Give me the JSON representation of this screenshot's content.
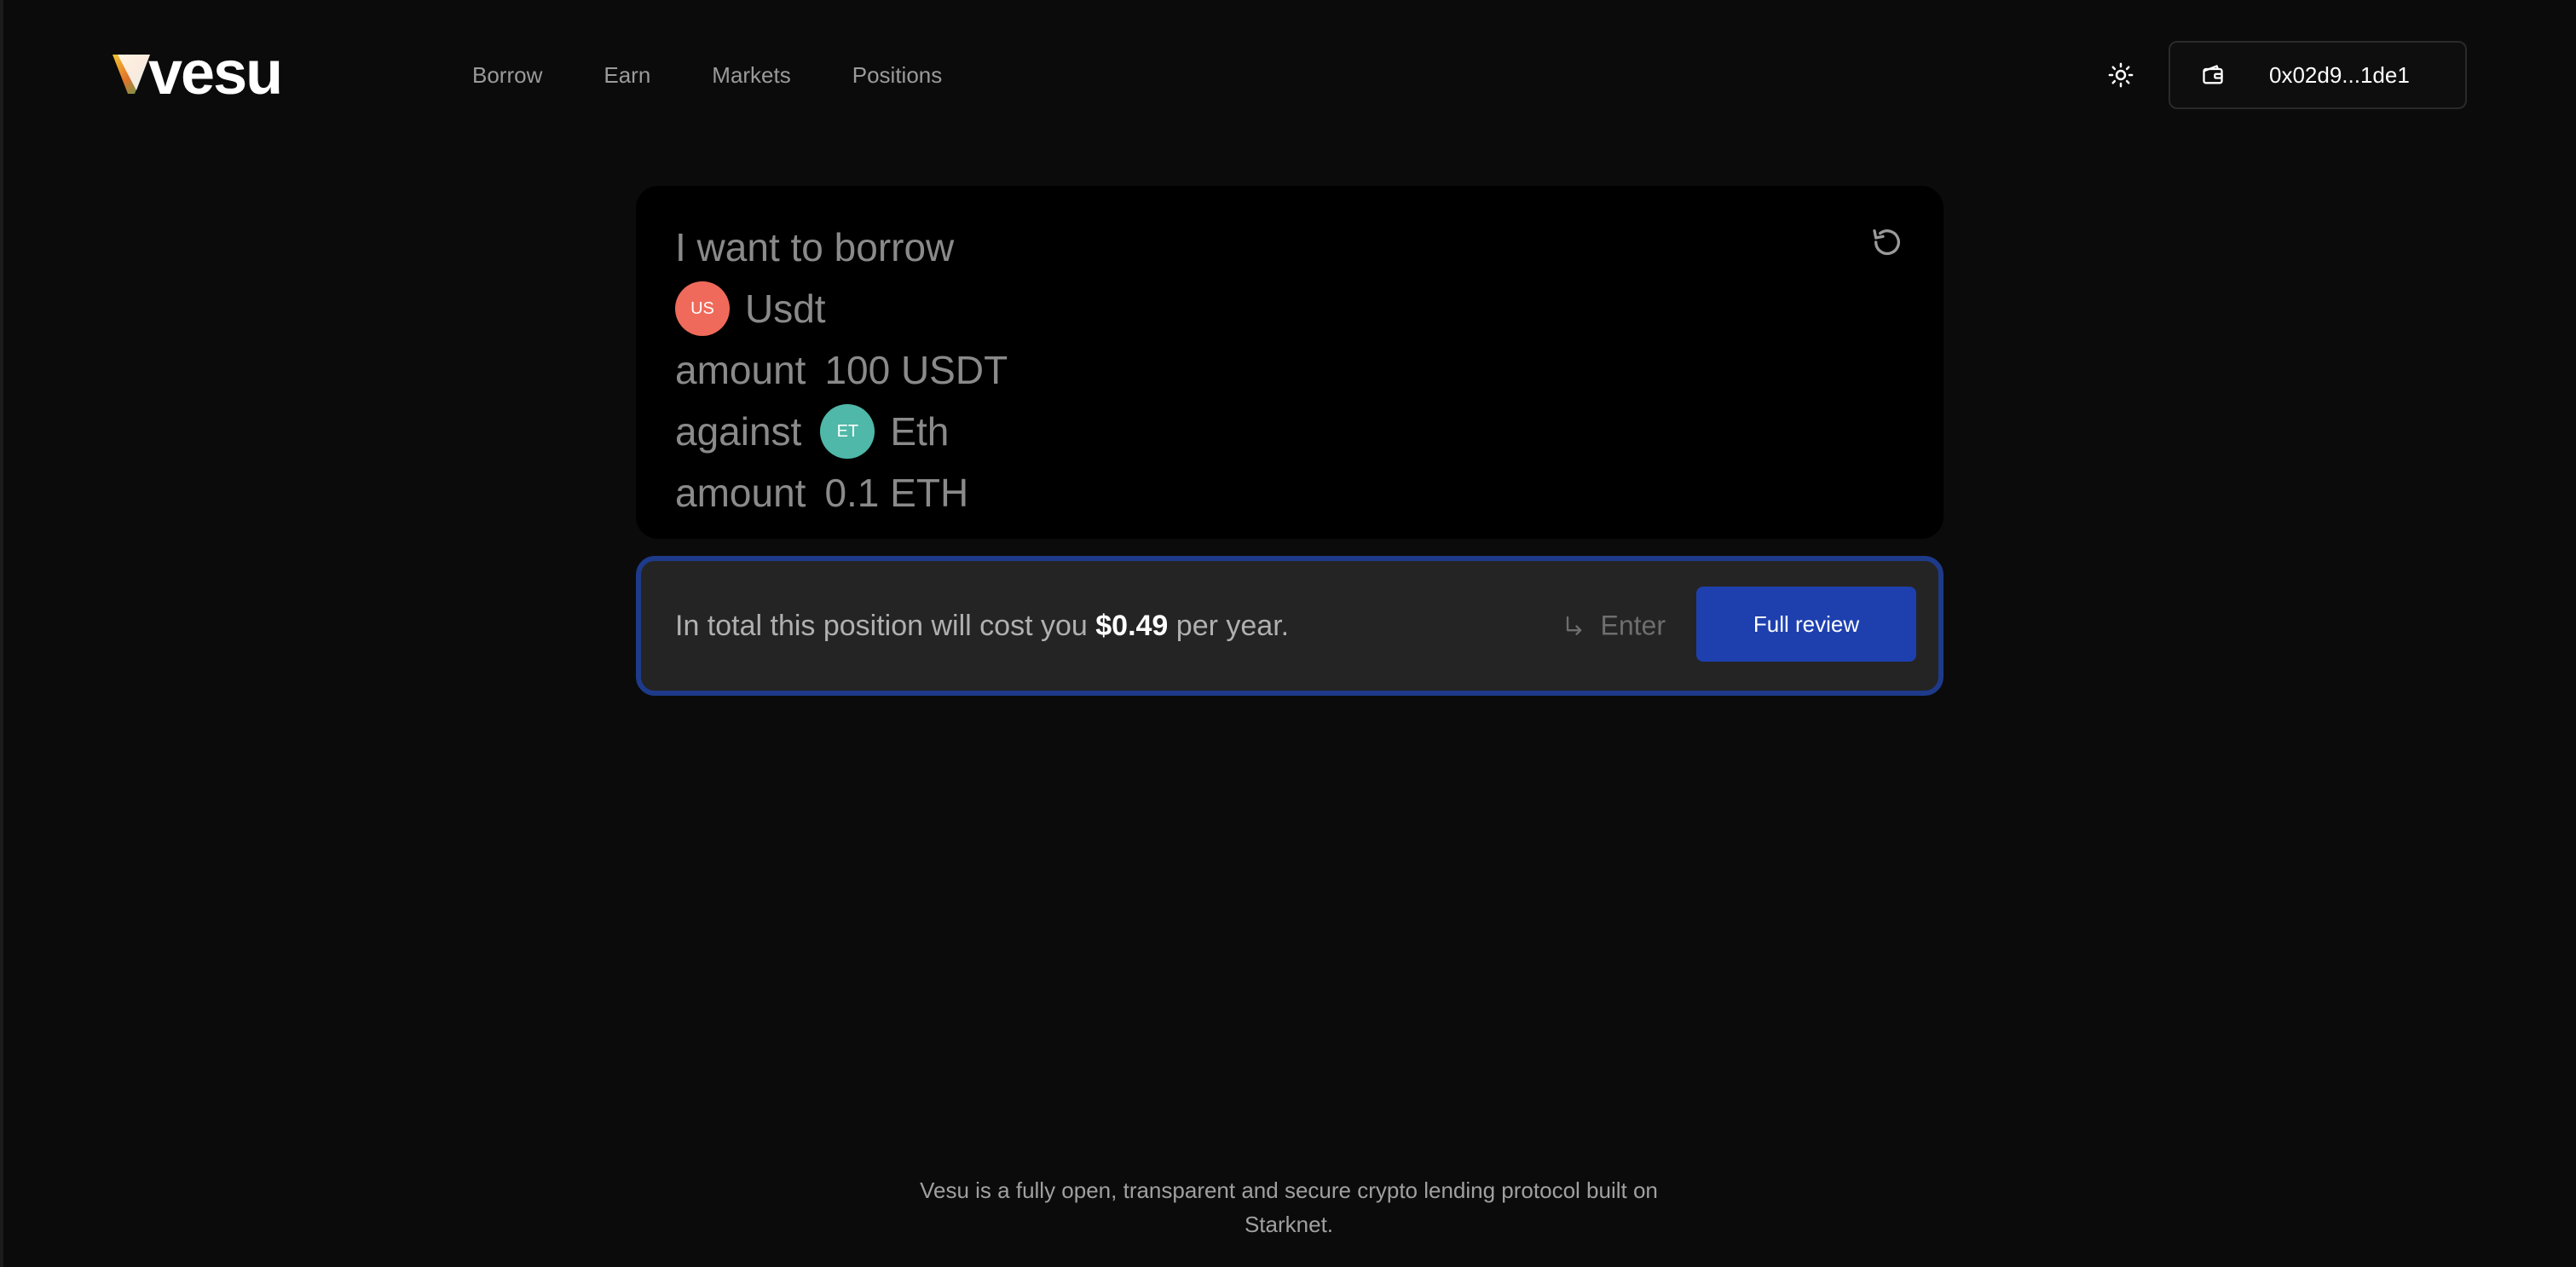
{
  "header": {
    "logo_text": "vesu",
    "nav": [
      "Borrow",
      "Earn",
      "Markets",
      "Positions"
    ],
    "wallet_address": "0x02d9...1de1"
  },
  "borrow": {
    "intro": "I want to borrow",
    "borrow_token": {
      "badge": "US",
      "name": "Usdt",
      "color": "#ef6a5a"
    },
    "amount_label": "amount",
    "borrow_amount": "100 USDT",
    "against_label": "against",
    "collateral_token": {
      "badge": "ET",
      "name": "Eth",
      "color": "#4fb8a8"
    },
    "collateral_amount_label": "amount",
    "collateral_amount": "0.1 ETH"
  },
  "summary": {
    "prefix": "In total this position will cost you",
    "cost": "$0.49",
    "suffix": "per year.",
    "enter_hint": "Enter",
    "review_button": "Full review"
  },
  "footer": {
    "text": "Vesu is a fully open, transparent and secure crypto lending protocol built on Starknet."
  },
  "colors": {
    "background": "#0b0b0b",
    "accent": "#1e40af",
    "border_accent": "#1e3a8a"
  },
  "icons": [
    "vesu-logo-icon",
    "sun-icon",
    "wallet-icon",
    "reset-icon",
    "enter-arrow-icon"
  ]
}
